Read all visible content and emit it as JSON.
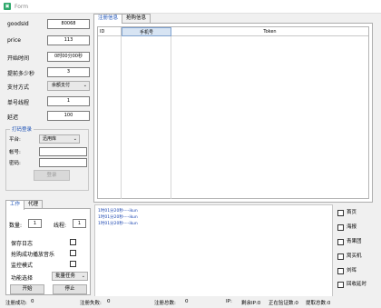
{
  "window": {
    "title": "Form",
    "icon": "app-icon"
  },
  "params": [
    {
      "label": "goodsId",
      "value": "80068",
      "kind": "input"
    },
    {
      "label": "price",
      "value": "113",
      "kind": "input"
    },
    {
      "label": "开始时间",
      "value": "0时00分00秒",
      "kind": "input"
    },
    {
      "label": "提前多少秒",
      "value": "3",
      "kind": "input"
    },
    {
      "label": "支付方式",
      "value": "余额支付",
      "kind": "select"
    },
    {
      "label": "单号线程",
      "value": "1",
      "kind": "input"
    },
    {
      "label": "延迟",
      "value": "100",
      "kind": "input"
    }
  ],
  "login_group": {
    "title": "打码登录",
    "platform_label": "平台:",
    "platform_value": "迅用库",
    "account_label": "帐号:",
    "password_label": "密码:",
    "login_button": "登录"
  },
  "top_tabs": {
    "tab1": "注册信息",
    "tab2": "抢购信息"
  },
  "grid": {
    "col_id": "ID",
    "col_phone": "手机号",
    "col_token": "Token"
  },
  "low_tabs": {
    "tab1": "工作",
    "tab2": "代理"
  },
  "work": {
    "quantity_label": "数量:",
    "quantity_value": "1",
    "threads_label": "线程:",
    "threads_value": "1",
    "save_log": "保存日志",
    "success_sound": "抢购成功播放音乐",
    "monitor_mode": "监控模式",
    "func_label": "功能选择",
    "func_value": "批量任务",
    "start_button": "开始",
    "stop_button": "停止"
  },
  "log_lines": [
    {
      "prefix": "1时",
      "mid": "01分20秒",
      "arrow": "----",
      "text": "ikun"
    },
    {
      "prefix": "1时",
      "mid": "01分20秒",
      "arrow": "----",
      "text": "ikun"
    },
    {
      "prefix": "1时",
      "mid": "01分20秒",
      "arrow": "----",
      "text": "ikun"
    }
  ],
  "right_checks": [
    "首页",
    "海报",
    "青果团",
    "窝买机",
    "刘晖",
    "回收延时"
  ],
  "status": {
    "reg_success_label": "注册成功:",
    "reg_success_value": "0",
    "reg_fail_label": "注册失败:",
    "reg_fail_value": "0",
    "reg_total_label": "注册总数:",
    "reg_total_value": "0",
    "ip_label": "IP:",
    "remaining_ip": "剩余IP:0",
    "verifying": "正在验证数:0",
    "extract_total": "提取总数:0"
  }
}
